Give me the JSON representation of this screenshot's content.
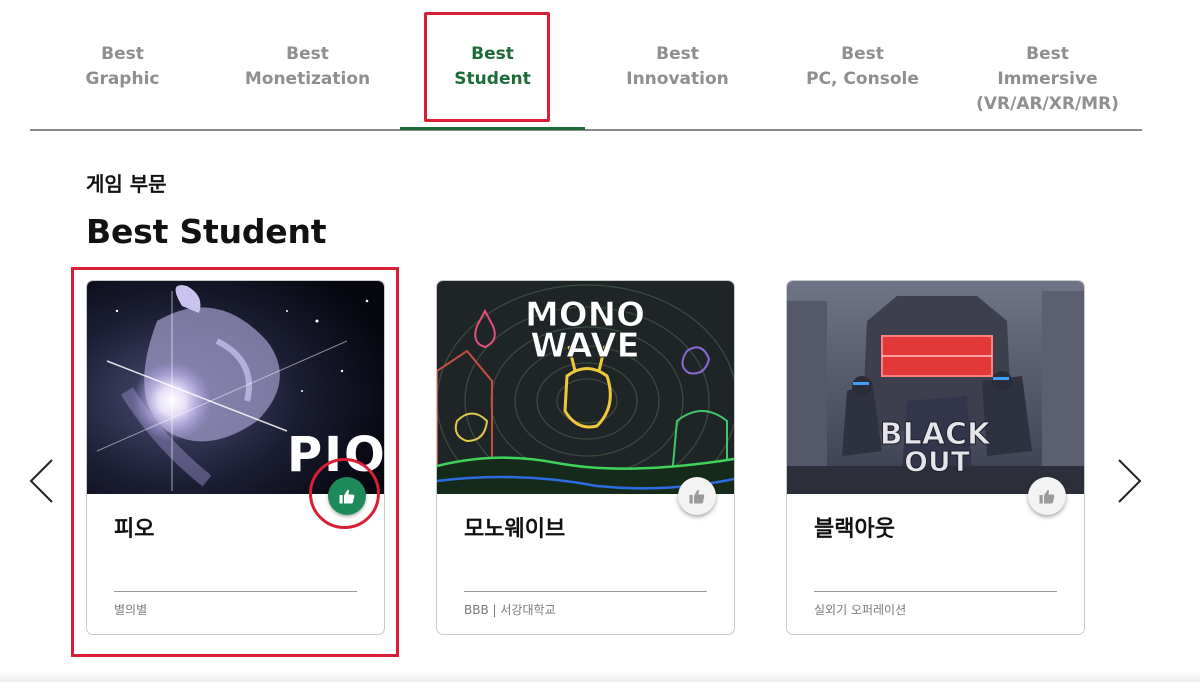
{
  "tabs": [
    {
      "line1": "Best",
      "line2": "Graphic",
      "line3": "",
      "active": false
    },
    {
      "line1": "Best",
      "line2": "Monetization",
      "line3": "",
      "active": false
    },
    {
      "line1": "Best",
      "line2": "Student",
      "line3": "",
      "active": true
    },
    {
      "line1": "Best",
      "line2": "Innovation",
      "line3": "",
      "active": false
    },
    {
      "line1": "Best",
      "line2": "PC, Console",
      "line3": "",
      "active": false
    },
    {
      "line1": "Best",
      "line2": "Immersive",
      "line3": "(VR/AR/XR/MR)",
      "active": false
    }
  ],
  "section": {
    "category": "게임 부문",
    "title": "Best Student"
  },
  "cards": [
    {
      "name": "피오",
      "team": "별의별",
      "liked": true,
      "thumb_text": "PIO"
    },
    {
      "name": "모노웨이브",
      "team": "BBB | 서강대학교",
      "liked": false,
      "thumb_text_1": "MONO",
      "thumb_text_2": "WAVE"
    },
    {
      "name": "블랙아웃",
      "team": "실외기 오퍼레이션",
      "liked": false,
      "thumb_text_1": "BLACK",
      "thumb_text_2": "OUT"
    }
  ],
  "colors": {
    "accent_green": "#1e6b3a",
    "like_green": "#1e8a5c",
    "highlight_red": "#d81f35",
    "tab_gray": "#8f8f8f"
  },
  "icons": {
    "like": "thumbs-up-icon",
    "prev": "chevron-left-icon",
    "next": "chevron-right-icon"
  }
}
